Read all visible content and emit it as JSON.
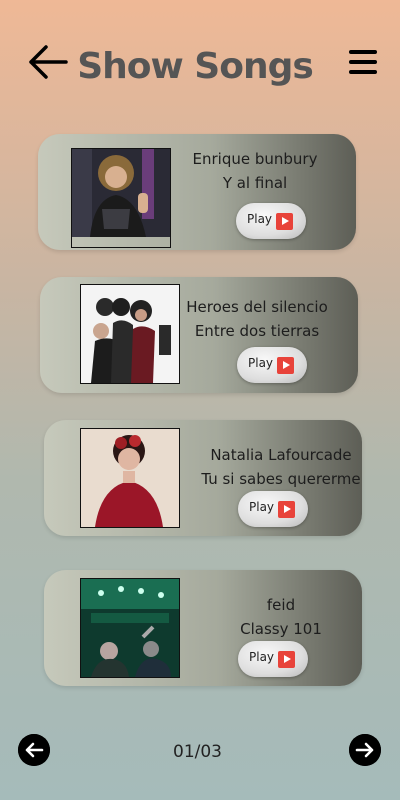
{
  "header": {
    "title": "Show Songs",
    "back_icon": "arrow-left-icon",
    "menu_icon": "hamburger-menu-icon"
  },
  "songs": [
    {
      "artist": "Enrique bunbury",
      "title": "Y al final",
      "play_label": "Play"
    },
    {
      "artist": "Heroes del silencio",
      "title": "Entre dos tierras",
      "play_label": "Play"
    },
    {
      "artist": "Natalia Lafourcade",
      "title": "Tu si sabes quererme",
      "play_label": "Play"
    },
    {
      "artist": "feid",
      "title": "Classy 101",
      "play_label": "Play"
    }
  ],
  "pagination": {
    "indicator": "01/03",
    "prev_icon": "arrow-left-circle-icon",
    "next_icon": "arrow-right-circle-icon"
  },
  "colors": {
    "play_icon": "#e8433a",
    "title": "#555555"
  }
}
